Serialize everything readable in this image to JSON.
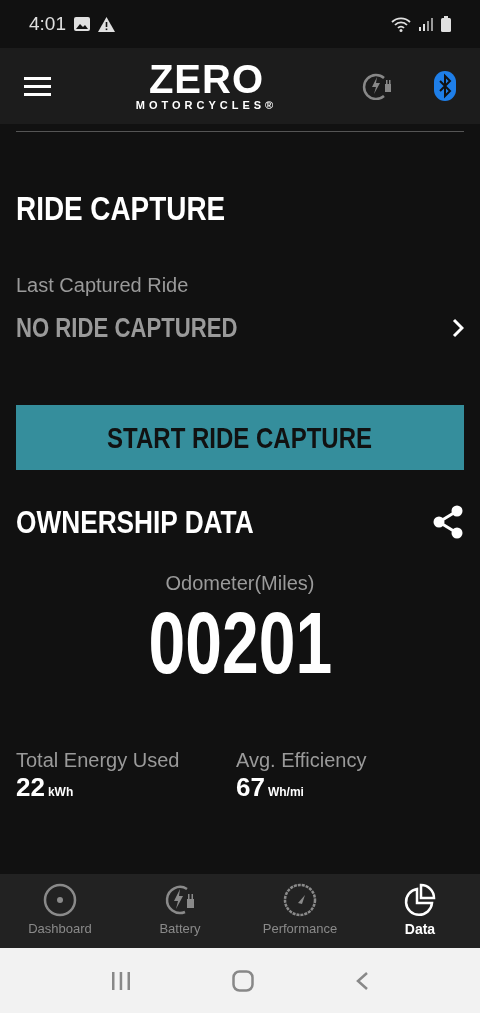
{
  "status_bar": {
    "time": "4:01"
  },
  "header": {
    "logo_main": "ZERO",
    "logo_sub": "MOTORCYCLES®"
  },
  "ride_capture": {
    "title": "RIDE CAPTURE",
    "last_label": "Last Captured Ride",
    "last_value": "NO RIDE CAPTURED",
    "button": "START RIDE CAPTURE"
  },
  "ownership": {
    "title": "OWNERSHIP DATA",
    "odometer_label": "Odometer(Miles)",
    "odometer": "00201",
    "stats": [
      {
        "label": "Total Energy Used",
        "value": "22",
        "unit": "kWh"
      },
      {
        "label": "Avg. Efficiency",
        "value": "67",
        "unit": "Wh/mi"
      }
    ]
  },
  "tabs": [
    {
      "kind": "dashboard",
      "label": "Dashboard",
      "selected": false
    },
    {
      "kind": "battery",
      "label": "Battery",
      "selected": false
    },
    {
      "kind": "performance",
      "label": "Performance",
      "selected": false
    },
    {
      "kind": "data",
      "label": "Data",
      "selected": true
    }
  ]
}
